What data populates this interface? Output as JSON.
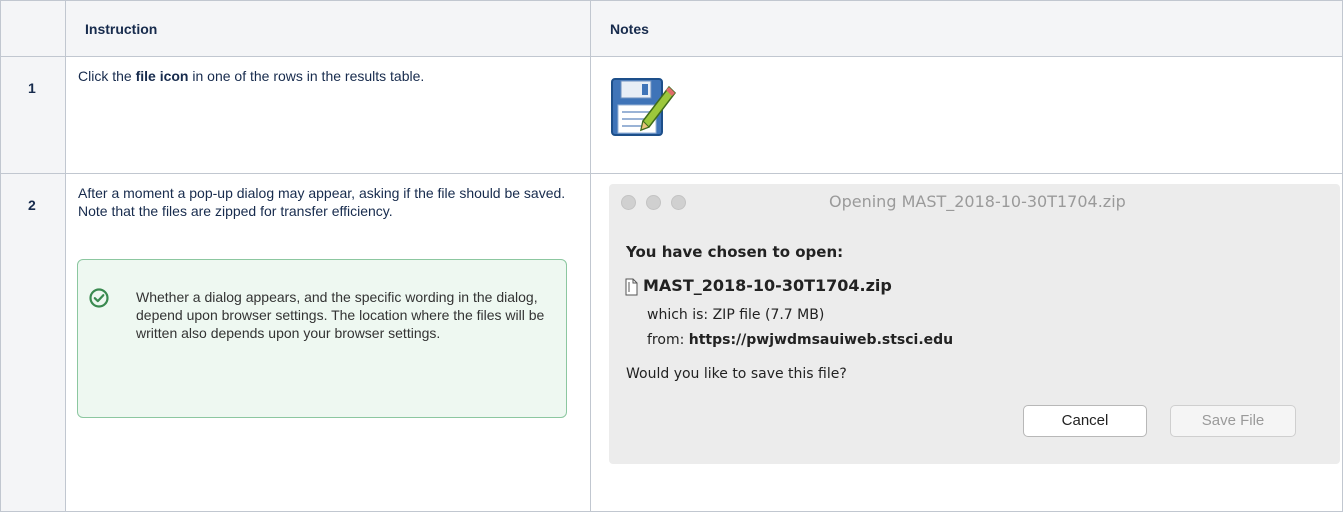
{
  "table": {
    "headers": {
      "num": "",
      "instruction": "Instruction",
      "notes": "Notes"
    },
    "rows": [
      {
        "num": "1",
        "instruction_pre": "Click the ",
        "instruction_bold": "file icon",
        "instruction_post": " in one of the rows in the results table.",
        "notes_icon": "floppy-save-icon"
      },
      {
        "num": "2",
        "instruction": "After a moment a pop-up dialog may appear, asking if the file should be saved. Note that the files are zipped for transfer efficiency.",
        "callout": {
          "icon": "check-circle-icon",
          "text": "Whether a dialog appears, and the specific wording in the dialog, depend upon browser settings. The location where the files will be written also depends upon your browser settings."
        }
      }
    ]
  },
  "dialog": {
    "title": "Opening MAST_2018-10-30T1704.zip",
    "heading": "You have chosen to open:",
    "filename": "MAST_2018-10-30T1704.zip",
    "which_label": "which is:",
    "which_value": "ZIP file (7.7 MB)",
    "from_label": "from:",
    "from_value": "https://pwjwdmsauiweb.stsci.edu",
    "question": "Would you like to save this file?",
    "cancel_label": "Cancel",
    "save_label": "Save File"
  },
  "colors": {
    "callout_bg": "#eef8f1",
    "callout_border": "#8cc7a0",
    "check_green": "#3a8a50",
    "header_bg": "#f4f5f7"
  }
}
